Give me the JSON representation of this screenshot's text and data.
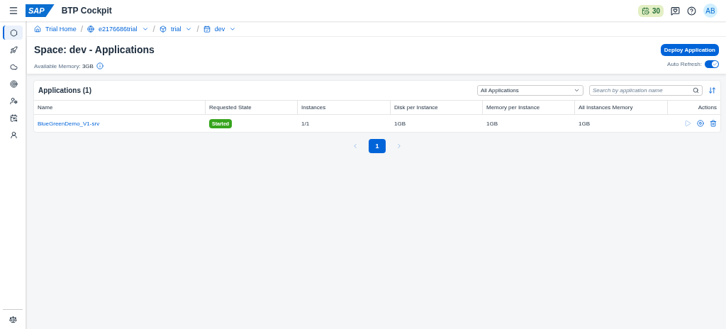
{
  "header": {
    "logo": "SAP",
    "title": "BTP Cockpit",
    "trial_days": "30",
    "avatar": "AB"
  },
  "sidebar": {
    "items": [
      {
        "selected": true
      },
      {
        "selected": false
      },
      {
        "selected": false
      },
      {
        "selected": false
      },
      {
        "selected": false
      },
      {
        "selected": false
      },
      {
        "selected": false
      }
    ]
  },
  "breadcrumbs": [
    {
      "label": "Trial Home",
      "dropdown": false
    },
    {
      "separator": "/",
      "label": "e2176686trial",
      "dropdown": true
    },
    {
      "separator": "/",
      "label": "trial",
      "dropdown": true
    },
    {
      "separator": "/",
      "label": "dev",
      "dropdown": true
    }
  ],
  "page": {
    "title": "Space: dev - Applications",
    "memory_label": "Available Memory:",
    "memory_value": "3GB",
    "deploy_button": "Deploy Application",
    "auto_refresh_label": "Auto Refresh:",
    "auto_refresh_on": true
  },
  "table": {
    "title": "Applications (1)",
    "filter": "All Applications",
    "search": {
      "placeholder": "Search by application name"
    },
    "columns": [
      "Name",
      "Requested State",
      "Instances",
      "Disk per Instance",
      "Memory per Instance",
      "All Instances Memory",
      "Actions"
    ],
    "rows": [
      {
        "name": "BlueGreenDemo_V1-srv",
        "state": "Started",
        "instances": "1/1",
        "disk": "1GB",
        "memory": "1GB",
        "all_memory": "1GB",
        "actions": [
          {
            "kind": "start",
            "disabled": true
          },
          {
            "kind": "stop",
            "disabled": false
          },
          {
            "kind": "delete",
            "disabled": false
          }
        ]
      }
    ]
  },
  "pagination": {
    "pages": [
      {
        "label": "1",
        "selected": true
      }
    ]
  }
}
